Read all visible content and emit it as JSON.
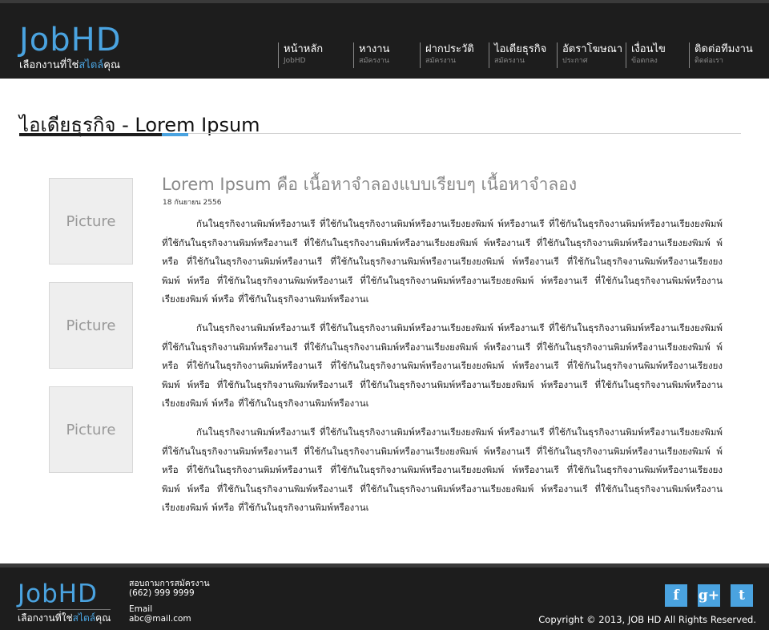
{
  "header": {
    "logo": "JobHD",
    "tagline_pre": "เลือกงานที่ใช่",
    "tagline_hl": "สไตล์",
    "tagline_post": "คุณ",
    "nav": [
      {
        "label": "หน้าหลัก",
        "sub": "JobHD"
      },
      {
        "label": "หางาน",
        "sub": "สมัครงาน"
      },
      {
        "label": "ฝากประวัติ",
        "sub": "สมัครงาน"
      },
      {
        "label": "ไอเดียธุรกิจ",
        "sub": "สมัครงาน"
      },
      {
        "label": "อัตราโฆษณา",
        "sub": "ประกาศ"
      },
      {
        "label": "เงื่อนไข",
        "sub": "ข้อตกลง"
      },
      {
        "label": "ติดต่อทีมงาน",
        "sub": "ติดต่อเรา"
      }
    ]
  },
  "page": {
    "title": "ไอเดียธุรกิจ - Lorem Ipsum"
  },
  "pictures": [
    "Picture",
    "Picture",
    "Picture"
  ],
  "article": {
    "title": "Lorem Ipsum คือ เนื้อหาจำลองแบบเรียบๆ เนื้อหาจำลอง",
    "date": "18 กันยายน 2556",
    "paragraphs": [
      "กันในธุรกิจงานพิมพ์หรืองานเรี ที่ใช้กันในธุรกิจงานพิมพ์หรืองานเรียงยงพิมพ์ พ์หรืองานเรี ที่ใช้กันในธุรกิจงานพิมพ์หรืองานเรียงยงพิมพ์ ที่ใช้กันในธุรกิจงานพิมพ์หรืองานเรี ที่ใช้กันในธุรกิจงานพิมพ์หรืองานเรียงยงพิมพ์ พ์หรืองานเรี ที่ใช้กันในธุรกิจงานพิมพ์หรืองานเรียงยงพิมพ์ พ์หรือ ที่ใช้กันในธุรกิจงานพิมพ์หรืองานเรี ที่ใช้กันในธุรกิจงานพิมพ์หรืองานเรียงยงพิมพ์ พ์หรืองานเรี ที่ใช้กันในธุรกิจงานพิมพ์หรืองานเรียงยงพิมพ์ พ์หรือ ที่ใช้กันในธุรกิจงานพิมพ์หรืองานเรี ที่ใช้กันในธุรกิจงานพิมพ์หรืองานเรียงยงพิมพ์ พ์หรืองานเรี ที่ใช้กันในธุรกิจงานพิมพ์หรืองานเรียงยงพิมพ์ พ์หรือ ที่ใช้กันในธุรกิจงานพิมพ์หรืองานเ",
      "กันในธุรกิจงานพิมพ์หรืองานเรี ที่ใช้กันในธุรกิจงานพิมพ์หรืองานเรียงยงพิมพ์ พ์หรืองานเรี ที่ใช้กันในธุรกิจงานพิมพ์หรืองานเรียงยงพิมพ์ ที่ใช้กันในธุรกิจงานพิมพ์หรืองานเรี ที่ใช้กันในธุรกิจงานพิมพ์หรืองานเรียงยงพิมพ์ พ์หรืองานเรี ที่ใช้กันในธุรกิจงานพิมพ์หรืองานเรียงยงพิมพ์ พ์หรือ ที่ใช้กันในธุรกิจงานพิมพ์หรืองานเรี ที่ใช้กันในธุรกิจงานพิมพ์หรืองานเรียงยงพิมพ์ พ์หรืองานเรี ที่ใช้กันในธุรกิจงานพิมพ์หรืองานเรียงยงพิมพ์ พ์หรือ ที่ใช้กันในธุรกิจงานพิมพ์หรืองานเรี ที่ใช้กันในธุรกิจงานพิมพ์หรืองานเรียงยงพิมพ์ พ์หรืองานเรี ที่ใช้กันในธุรกิจงานพิมพ์หรืองานเรียงยงพิมพ์ พ์หรือ ที่ใช้กันในธุรกิจงานพิมพ์หรืองานเ",
      "กันในธุรกิจงานพิมพ์หรืองานเรี ที่ใช้กันในธุรกิจงานพิมพ์หรืองานเรียงยงพิมพ์ พ์หรืองานเรี ที่ใช้กันในธุรกิจงานพิมพ์หรืองานเรียงยงพิมพ์ ที่ใช้กันในธุรกิจงานพิมพ์หรืองานเรี ที่ใช้กันในธุรกิจงานพิมพ์หรืองานเรียงยงพิมพ์ พ์หรืองานเรี ที่ใช้กันในธุรกิจงานพิมพ์หรืองานเรียงยงพิมพ์ พ์หรือ ที่ใช้กันในธุรกิจงานพิมพ์หรืองานเรี ที่ใช้กันในธุรกิจงานพิมพ์หรืองานเรียงยงพิมพ์ พ์หรืองานเรี ที่ใช้กันในธุรกิจงานพิมพ์หรืองานเรียงยงพิมพ์ พ์หรือ ที่ใช้กันในธุรกิจงานพิมพ์หรืองานเรี ที่ใช้กันในธุรกิจงานพิมพ์หรืองานเรียงยงพิมพ์ พ์หรืองานเรี ที่ใช้กันในธุรกิจงานพิมพ์หรืองานเรียงยงพิมพ์ พ์หรือ ที่ใช้กันในธุรกิจงานพิมพ์หรืองานเ"
    ]
  },
  "footer": {
    "logo": "JobHD",
    "tagline_pre": "เลือกงานที่ใช่",
    "tagline_hl": "สไตล์",
    "tagline_post": "คุณ",
    "contact_label": "สอบถามการสมัครงาน",
    "phone": "(662) 999 9999",
    "email_label": "Email",
    "email": "abc@mail.com",
    "social": [
      {
        "name": "facebook-icon",
        "glyph": "f"
      },
      {
        "name": "google-plus-icon",
        "glyph": "g+"
      },
      {
        "name": "twitter-icon",
        "glyph": "t"
      }
    ],
    "copyright": "Copyright © 2013, JOB HD All Rights Reserved."
  },
  "colors": {
    "accent": "#4aa3e0",
    "header_bg": "#1d1d1d",
    "picture_bg": "#eeeeee"
  }
}
